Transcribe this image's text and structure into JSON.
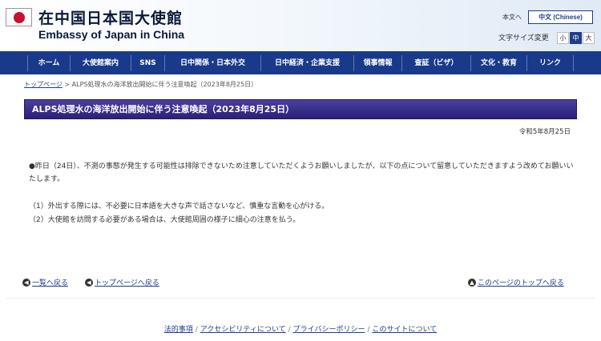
{
  "header": {
    "title_ja": "在中国日本国大使館",
    "title_en": "Embassy of Japan in China",
    "lang_ja": "本文へ",
    "lang_zh": "中文 (Chinese)",
    "font_size_label": "文字サイズ変更",
    "font_sizes": [
      "小",
      "中",
      "大"
    ],
    "font_size_selected": "中"
  },
  "nav": {
    "items": [
      "ホーム",
      "大使館案内",
      "SNS",
      "日中関係・日本外交",
      "日中経済・企業支援",
      "領事情報",
      "査証（ビザ）",
      "文化・教育",
      "リンク"
    ]
  },
  "breadcrumb": {
    "top": "トップページ",
    "separator": ">",
    "current": "ALPS処理水の海洋放出開始に伴う注意喚起（2023年8月25日）"
  },
  "page": {
    "title": "ALPS処理水の海洋放出開始に伴う注意喚起（2023年8月25日）",
    "date": "令和5年8月25日",
    "body": "●昨日（24日）、不測の事態が発生する可能性は排除できないため注意していただくようお願いしましたが、以下の点について留意していただきますよう改めてお願いいたします。",
    "items": [
      "（1）外出する際には、不必要に日本語を大きな声で話さないなど、慎重な言動を心がける。",
      "（2）大使館を訪問する必要がある場合は、大使館周囲の様子に細心の注意を払う。"
    ]
  },
  "page_links": {
    "back": "一覧へ戻る",
    "top_page": "トップページへ戻る",
    "page_top": "このページのトップへ戻る"
  },
  "footer": {
    "links": [
      "法的事項",
      "アクセシビリティについて",
      "プライバシーポリシー",
      "このサイトについて"
    ],
    "separator": "/"
  },
  "colors": {
    "nav_bg": "#193a8a",
    "title_bar": "#2a2178",
    "link": "#1f3d8a",
    "flag_red": "#c8102e"
  }
}
